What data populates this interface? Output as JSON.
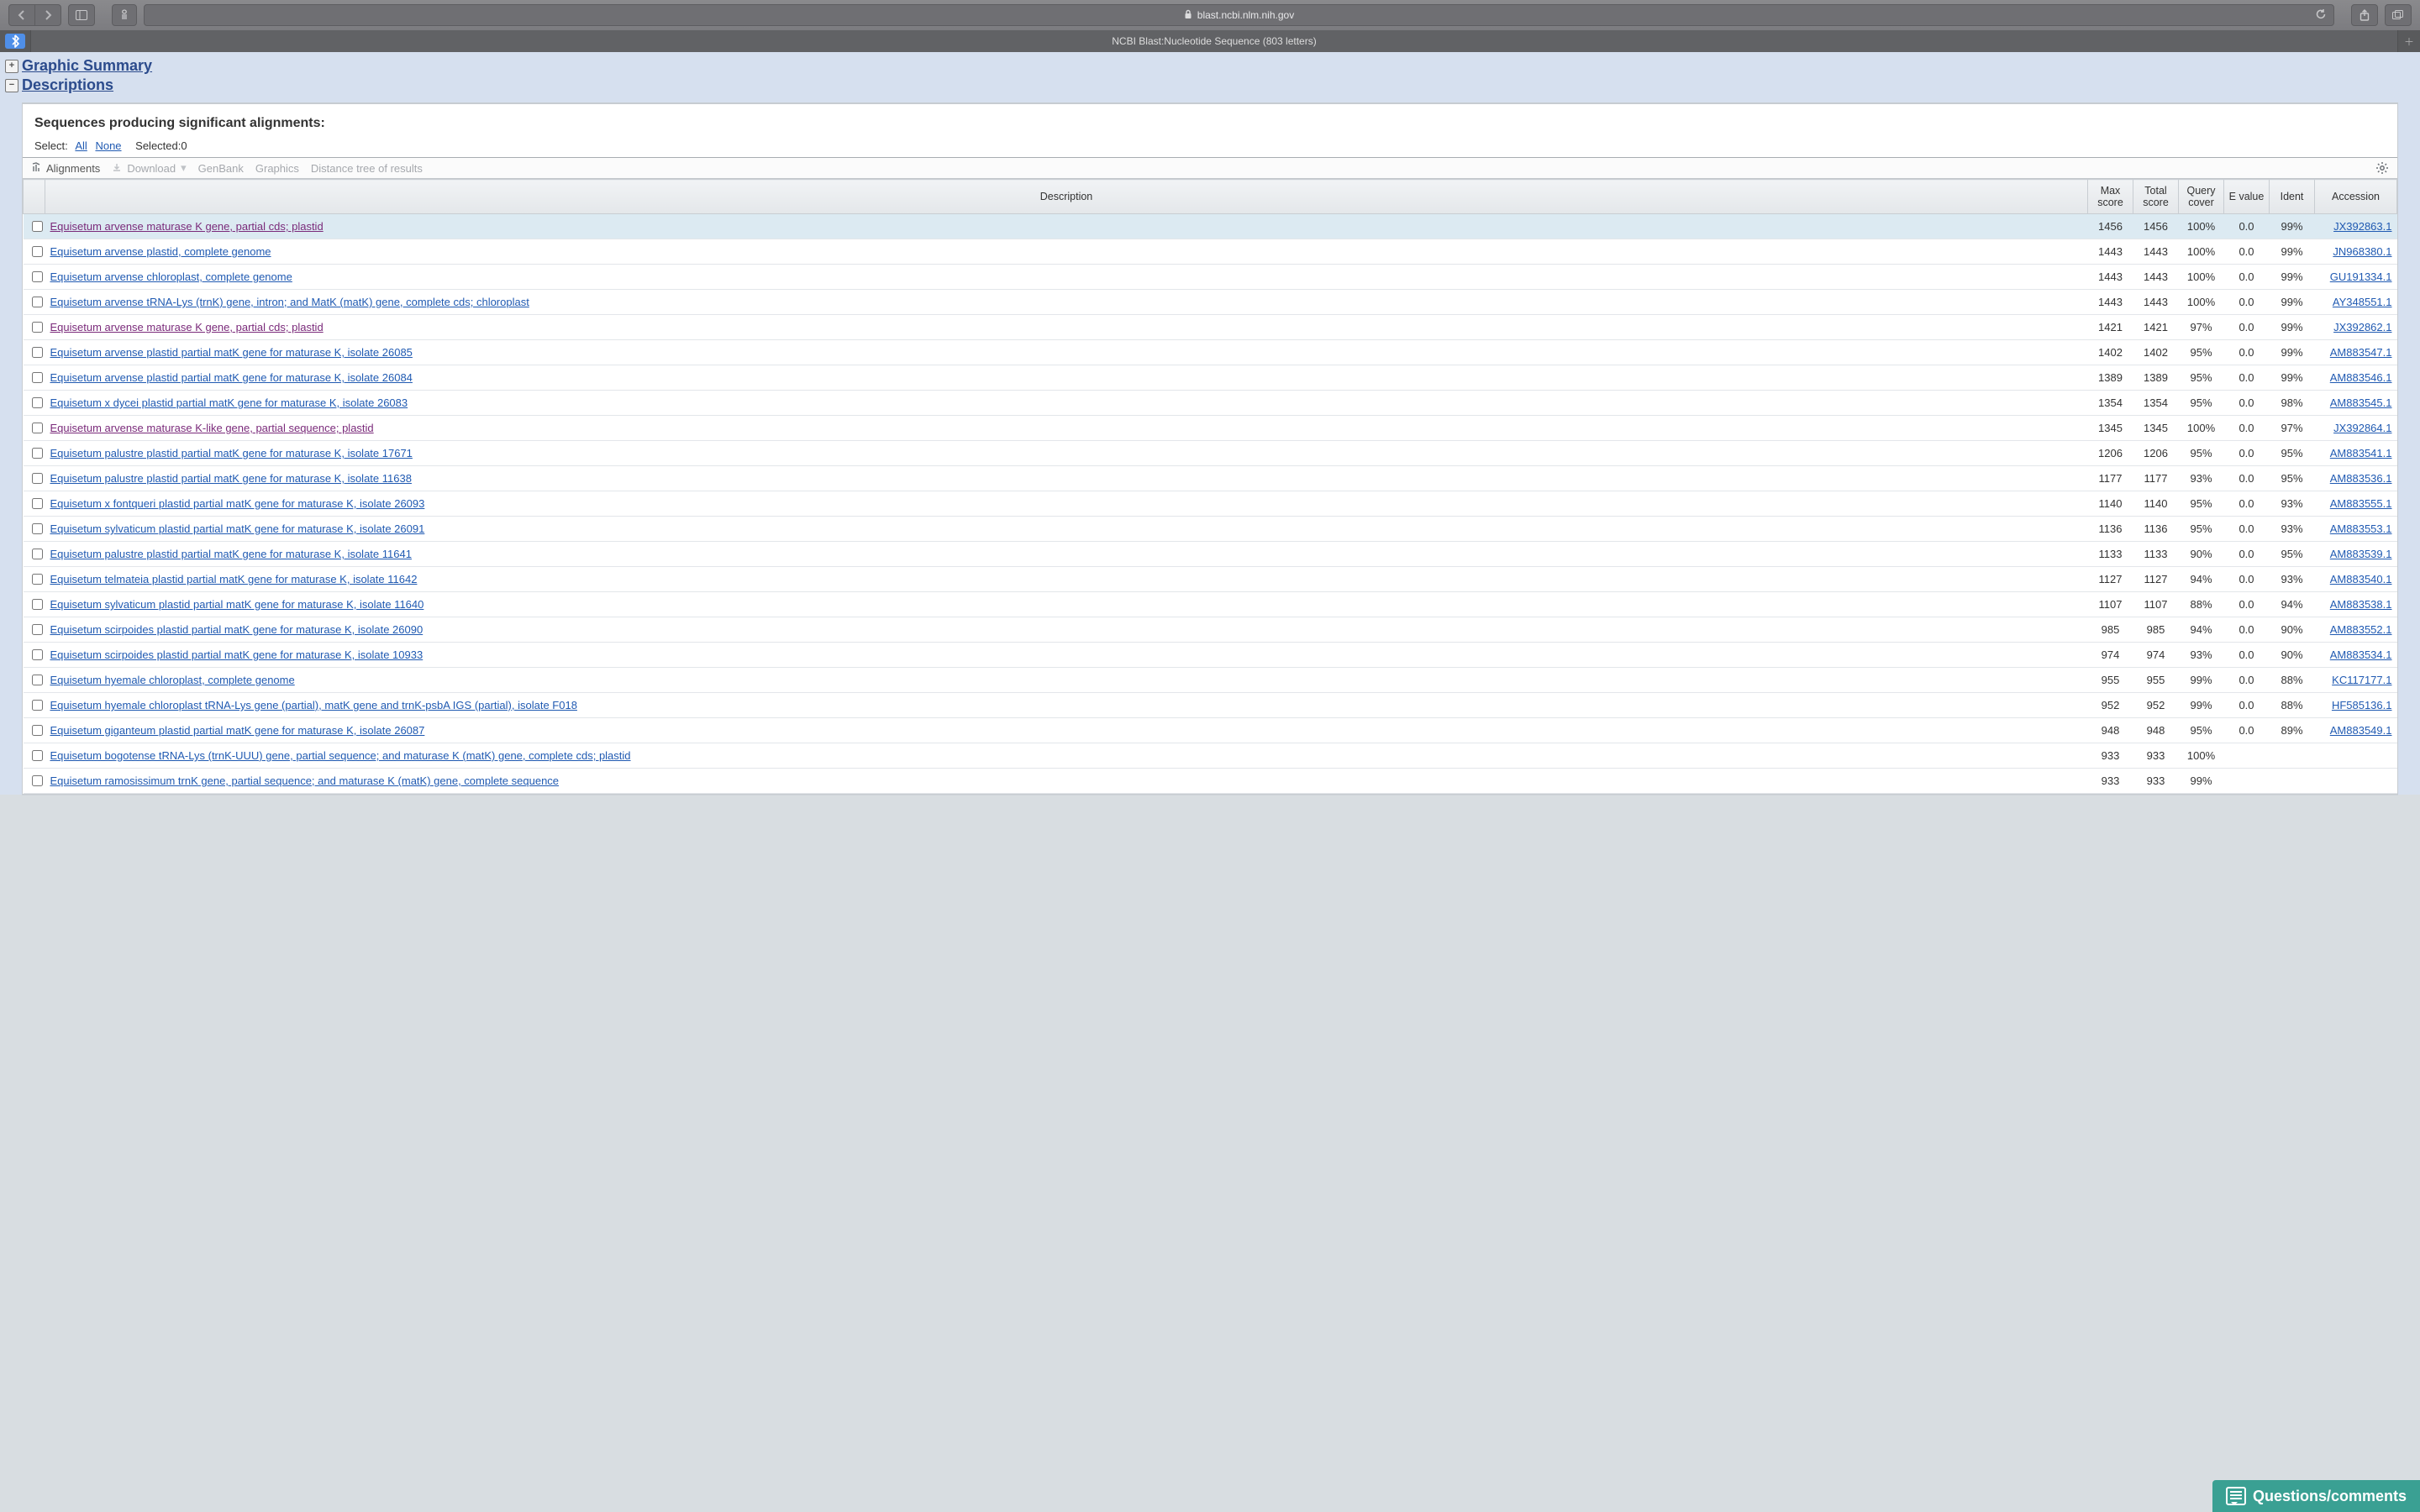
{
  "browser": {
    "url_display": "blast.ncbi.nlm.nih.gov",
    "tab_title": "NCBI Blast:Nucleotide Sequence (803 letters)"
  },
  "sections": {
    "graphic": "Graphic Summary",
    "descriptions": "Descriptions"
  },
  "panel": {
    "heading": "Sequences producing significant alignments:",
    "select_label": "Select:",
    "select_all": "All",
    "select_none": "None",
    "selected": "Selected:0",
    "tb_alignments": "Alignments",
    "tb_download": "Download",
    "tb_genbank": "GenBank",
    "tb_graphics": "Graphics",
    "tb_tree": "Distance tree of results"
  },
  "columns": {
    "description": "Description",
    "max": "Max score",
    "total": "Total score",
    "cover": "Query cover",
    "evalue": "E value",
    "ident": "Ident",
    "acc": "Accession"
  },
  "rows": [
    {
      "hl": true,
      "desc": "Equisetum arvense maturase K gene, partial cds; plastid",
      "max": "1456",
      "total": "1456",
      "cover": "100%",
      "e": "0.0",
      "ident": "99%",
      "acc": "JX392863.1",
      "v": true
    },
    {
      "desc": "Equisetum arvense plastid, complete genome",
      "max": "1443",
      "total": "1443",
      "cover": "100%",
      "e": "0.0",
      "ident": "99%",
      "acc": "JN968380.1"
    },
    {
      "desc": "Equisetum arvense chloroplast, complete genome",
      "max": "1443",
      "total": "1443",
      "cover": "100%",
      "e": "0.0",
      "ident": "99%",
      "acc": "GU191334.1"
    },
    {
      "desc": "Equisetum arvense tRNA-Lys (trnK) gene, intron; and MatK (matK) gene, complete cds; chloroplast",
      "max": "1443",
      "total": "1443",
      "cover": "100%",
      "e": "0.0",
      "ident": "99%",
      "acc": "AY348551.1"
    },
    {
      "desc": "Equisetum arvense maturase K gene, partial cds; plastid",
      "max": "1421",
      "total": "1421",
      "cover": "97%",
      "e": "0.0",
      "ident": "99%",
      "acc": "JX392862.1",
      "v": true
    },
    {
      "desc": "Equisetum arvense plastid partial matK gene for maturase K, isolate 26085",
      "max": "1402",
      "total": "1402",
      "cover": "95%",
      "e": "0.0",
      "ident": "99%",
      "acc": "AM883547.1"
    },
    {
      "desc": "Equisetum arvense plastid partial matK gene for maturase K, isolate 26084",
      "max": "1389",
      "total": "1389",
      "cover": "95%",
      "e": "0.0",
      "ident": "99%",
      "acc": "AM883546.1"
    },
    {
      "desc": "Equisetum x dycei plastid partial matK gene for maturase K, isolate 26083",
      "max": "1354",
      "total": "1354",
      "cover": "95%",
      "e": "0.0",
      "ident": "98%",
      "acc": "AM883545.1"
    },
    {
      "desc": "Equisetum arvense maturase K-like gene, partial sequence; plastid",
      "max": "1345",
      "total": "1345",
      "cover": "100%",
      "e": "0.0",
      "ident": "97%",
      "acc": "JX392864.1",
      "v": true
    },
    {
      "desc": "Equisetum palustre plastid partial matK gene for maturase K, isolate 17671",
      "max": "1206",
      "total": "1206",
      "cover": "95%",
      "e": "0.0",
      "ident": "95%",
      "acc": "AM883541.1"
    },
    {
      "desc": "Equisetum palustre plastid partial matK gene for maturase K, isolate 11638",
      "max": "1177",
      "total": "1177",
      "cover": "93%",
      "e": "0.0",
      "ident": "95%",
      "acc": "AM883536.1"
    },
    {
      "desc": "Equisetum x fontqueri plastid partial matK gene for maturase K, isolate 26093",
      "max": "1140",
      "total": "1140",
      "cover": "95%",
      "e": "0.0",
      "ident": "93%",
      "acc": "AM883555.1"
    },
    {
      "desc": "Equisetum sylvaticum plastid partial matK gene for maturase K, isolate 26091",
      "max": "1136",
      "total": "1136",
      "cover": "95%",
      "e": "0.0",
      "ident": "93%",
      "acc": "AM883553.1"
    },
    {
      "desc": "Equisetum palustre plastid partial matK gene for maturase K, isolate 11641",
      "max": "1133",
      "total": "1133",
      "cover": "90%",
      "e": "0.0",
      "ident": "95%",
      "acc": "AM883539.1"
    },
    {
      "desc": "Equisetum telmateia plastid partial matK gene for maturase K, isolate 11642",
      "max": "1127",
      "total": "1127",
      "cover": "94%",
      "e": "0.0",
      "ident": "93%",
      "acc": "AM883540.1"
    },
    {
      "desc": "Equisetum sylvaticum plastid partial matK gene for maturase K, isolate 11640",
      "max": "1107",
      "total": "1107",
      "cover": "88%",
      "e": "0.0",
      "ident": "94%",
      "acc": "AM883538.1"
    },
    {
      "desc": "Equisetum scirpoides plastid partial matK gene for maturase K, isolate 26090",
      "max": "985",
      "total": "985",
      "cover": "94%",
      "e": "0.0",
      "ident": "90%",
      "acc": "AM883552.1"
    },
    {
      "desc": "Equisetum scirpoides plastid partial matK gene for maturase K, isolate 10933",
      "max": "974",
      "total": "974",
      "cover": "93%",
      "e": "0.0",
      "ident": "90%",
      "acc": "AM883534.1"
    },
    {
      "desc": "Equisetum hyemale chloroplast, complete genome",
      "max": "955",
      "total": "955",
      "cover": "99%",
      "e": "0.0",
      "ident": "88%",
      "acc": "KC117177.1"
    },
    {
      "desc": "Equisetum hyemale chloroplast tRNA-Lys gene (partial), matK gene and trnK-psbA IGS (partial), isolate F018",
      "max": "952",
      "total": "952",
      "cover": "99%",
      "e": "0.0",
      "ident": "88%",
      "acc": "HF585136.1"
    },
    {
      "desc": "Equisetum giganteum plastid partial matK gene for maturase K, isolate 26087",
      "max": "948",
      "total": "948",
      "cover": "95%",
      "e": "0.0",
      "ident": "89%",
      "acc": "AM883549.1"
    },
    {
      "desc": "Equisetum bogotense tRNA-Lys (trnK-UUU) gene, partial sequence; and maturase K (matK) gene, complete cds; plastid",
      "max": "933",
      "total": "933",
      "cover": "100%",
      "e": "",
      "ident": "",
      "acc": ""
    },
    {
      "desc": "Equisetum ramosissimum trnK gene, partial sequence; and maturase K (matK) gene, complete sequence",
      "max": "933",
      "total": "933",
      "cover": "99%",
      "e": "",
      "ident": "",
      "acc": ""
    }
  ],
  "feedback": "Questions/comments"
}
